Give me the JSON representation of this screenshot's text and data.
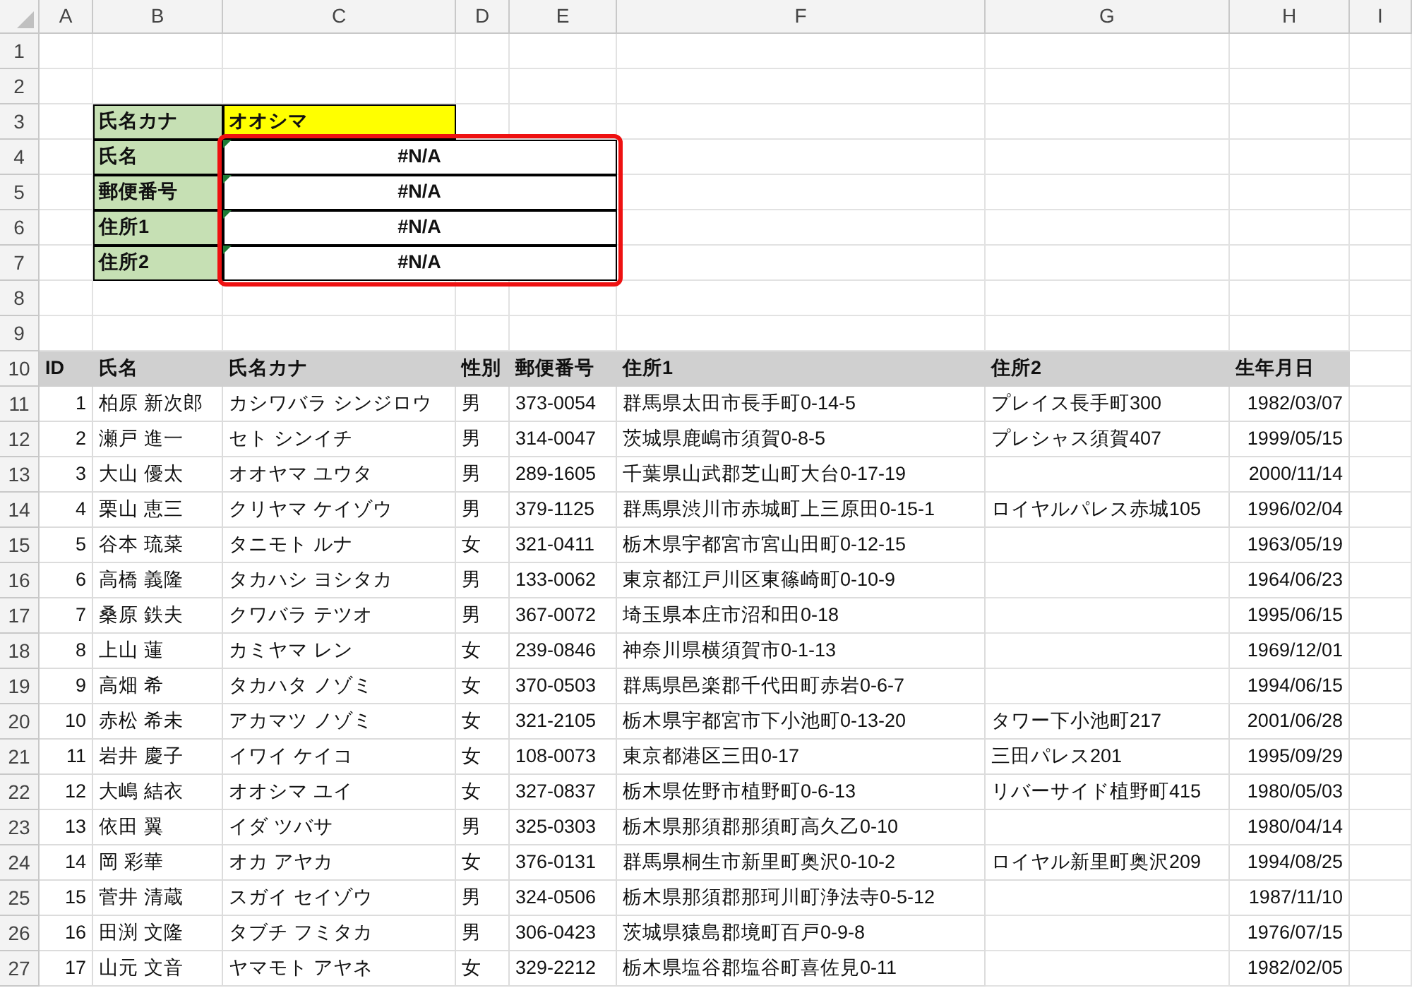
{
  "column_headers": [
    "A",
    "B",
    "C",
    "D",
    "E",
    "F",
    "G",
    "H",
    "I"
  ],
  "row_numbers": [
    "1",
    "2",
    "3",
    "4",
    "5",
    "6",
    "7",
    "8",
    "9",
    "10",
    "11",
    "12",
    "13",
    "14",
    "15",
    "16",
    "17",
    "18",
    "19",
    "20",
    "21",
    "22",
    "23",
    "24",
    "25",
    "26",
    "27"
  ],
  "lookup": {
    "highlighted": true,
    "rows": [
      {
        "label": "氏名カナ",
        "value": "オオシマ",
        "kind": "input",
        "error_indicator": false
      },
      {
        "label": "氏名",
        "value": "#N/A",
        "kind": "result",
        "error_indicator": true
      },
      {
        "label": "郵便番号",
        "value": "#N/A",
        "kind": "result",
        "error_indicator": true
      },
      {
        "label": "住所1",
        "value": "#N/A",
        "kind": "result",
        "error_indicator": true
      },
      {
        "label": "住所2",
        "value": "#N/A",
        "kind": "result",
        "error_indicator": true
      }
    ]
  },
  "table": {
    "columns": [
      "ID",
      "氏名",
      "氏名カナ",
      "性別",
      "郵便番号",
      "住所1",
      "住所2",
      "生年月日"
    ],
    "rows": [
      {
        "id": "1",
        "name": "柏原 新次郎",
        "kana": "カシワバラ シンジロウ",
        "gender": "男",
        "postal": "373-0054",
        "address1": "群馬県太田市長手町0-14-5",
        "address2": "プレイス長手町300",
        "birthdate": "1982/03/07"
      },
      {
        "id": "2",
        "name": "瀬戸 進一",
        "kana": "セト シンイチ",
        "gender": "男",
        "postal": "314-0047",
        "address1": "茨城県鹿嶋市須賀0-8-5",
        "address2": "プレシャス須賀407",
        "birthdate": "1999/05/15"
      },
      {
        "id": "3",
        "name": "大山 優太",
        "kana": "オオヤマ ユウタ",
        "gender": "男",
        "postal": "289-1605",
        "address1": "千葉県山武郡芝山町大台0-17-19",
        "birthdate": "2000/11/14"
      },
      {
        "id": "4",
        "name": "栗山 恵三",
        "kana": "クリヤマ ケイゾウ",
        "gender": "男",
        "postal": "379-1125",
        "address1": "群馬県渋川市赤城町上三原田0-15-1",
        "address2": "ロイヤルパレス赤城105",
        "birthdate": "1996/02/04"
      },
      {
        "id": "5",
        "name": "谷本 琉菜",
        "kana": "タニモト ルナ",
        "gender": "女",
        "postal": "321-0411",
        "address1": "栃木県宇都宮市宮山田町0-12-15",
        "birthdate": "1963/05/19"
      },
      {
        "id": "6",
        "name": "高橋 義隆",
        "kana": "タカハシ ヨシタカ",
        "gender": "男",
        "postal": "133-0062",
        "address1": "東京都江戸川区東篠崎町0-10-9",
        "birthdate": "1964/06/23"
      },
      {
        "id": "7",
        "name": "桑原 鉄夫",
        "kana": "クワバラ テツオ",
        "gender": "男",
        "postal": "367-0072",
        "address1": "埼玉県本庄市沼和田0-18",
        "birthdate": "1995/06/15"
      },
      {
        "id": "8",
        "name": "上山 蓮",
        "kana": "カミヤマ レン",
        "gender": "女",
        "postal": "239-0846",
        "address1": "神奈川県横須賀市0-1-13",
        "birthdate": "1969/12/01"
      },
      {
        "id": "9",
        "name": "高畑 希",
        "kana": "タカハタ ノゾミ",
        "gender": "女",
        "postal": "370-0503",
        "address1": "群馬県邑楽郡千代田町赤岩0-6-7",
        "birthdate": "1994/06/15"
      },
      {
        "id": "10",
        "name": "赤松 希未",
        "kana": "アカマツ ノゾミ",
        "gender": "女",
        "postal": "321-2105",
        "address1": "栃木県宇都宮市下小池町0-13-20",
        "address2": "タワー下小池町217",
        "birthdate": "2001/06/28"
      },
      {
        "id": "11",
        "name": "岩井 慶子",
        "kana": "イワイ ケイコ",
        "gender": "女",
        "postal": "108-0073",
        "address1": "東京都港区三田0-17",
        "address2": "三田パレス201",
        "birthdate": "1995/09/29"
      },
      {
        "id": "12",
        "name": "大嶋 結衣",
        "kana": "オオシマ ユイ",
        "gender": "女",
        "postal": "327-0837",
        "address1": "栃木県佐野市植野町0-6-13",
        "address2": "リバーサイド植野町415",
        "birthdate": "1980/05/03"
      },
      {
        "id": "13",
        "name": "依田 翼",
        "kana": "イダ ツバサ",
        "gender": "男",
        "postal": "325-0303",
        "address1": "栃木県那須郡那須町高久乙0-10",
        "birthdate": "1980/04/14"
      },
      {
        "id": "14",
        "name": "岡 彩華",
        "kana": "オカ アヤカ",
        "gender": "女",
        "postal": "376-0131",
        "address1": "群馬県桐生市新里町奥沢0-10-2",
        "address2": "ロイヤル新里町奥沢209",
        "birthdate": "1994/08/25"
      },
      {
        "id": "15",
        "name": "菅井 清蔵",
        "kana": "スガイ セイゾウ",
        "gender": "男",
        "postal": "324-0506",
        "address1": "栃木県那須郡那珂川町浄法寺0-5-12",
        "birthdate": "1987/11/10"
      },
      {
        "id": "16",
        "name": "田渕 文隆",
        "kana": "タブチ フミタカ",
        "gender": "男",
        "postal": "306-0423",
        "address1": "茨城県猿島郡境町百戸0-9-8",
        "birthdate": "1976/07/15"
      },
      {
        "id": "17",
        "name": "山元 文音",
        "kana": "ヤマモト アヤネ",
        "gender": "女",
        "postal": "329-2212",
        "address1": "栃木県塩谷郡塩谷町喜佐見0-11",
        "birthdate": "1982/02/05"
      }
    ]
  }
}
